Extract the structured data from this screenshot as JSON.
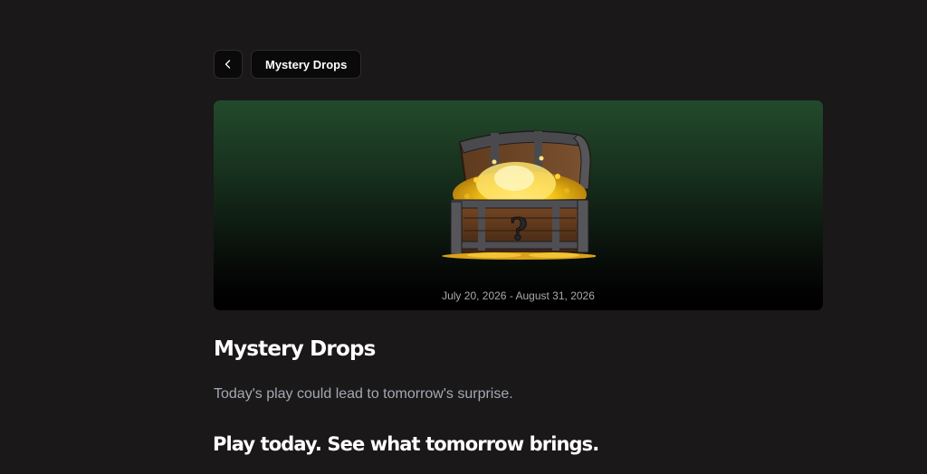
{
  "header": {
    "back_icon": "chevron-left-icon",
    "breadcrumb_label": "Mystery Drops"
  },
  "banner": {
    "image": "treasure-chest-icon",
    "date_range": "July 20, 2026 - August 31, 2026",
    "gradient_top": "#234a2c",
    "gradient_bottom": "#000000"
  },
  "content": {
    "title": "Mystery Drops",
    "subtitle": "Today's play could lead to tomorrow's surprise.",
    "tagline": "Play today. See what tomorrow brings."
  },
  "colors": {
    "background": "#1a1819",
    "button_bg": "#0a0a0a",
    "muted_text": "#a3a9b2"
  }
}
